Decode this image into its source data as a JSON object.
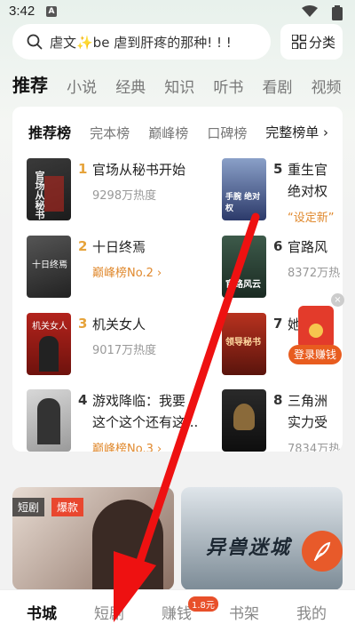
{
  "status": {
    "time": "3:42",
    "notif_letter": "A"
  },
  "search": {
    "placeholder_text": "虐文✨be 虐到肝疼的那种! ! !",
    "category_label": "分类"
  },
  "top_tabs": [
    "推荐",
    "小说",
    "经典",
    "知识",
    "听书",
    "看剧",
    "视频"
  ],
  "rank": {
    "tabs": [
      "推荐榜",
      "完本榜",
      "巅峰榜",
      "口碑榜"
    ],
    "full_label": "完整榜单 ›",
    "books": [
      {
        "num": "1",
        "title": "官场从秘书开始",
        "sub": "9298万热度",
        "cover_text": "官场从秘书"
      },
      {
        "num": "2",
        "title": "十日终焉",
        "sub": "巅峰榜No.2 ›",
        "cover_text": "十日终焉"
      },
      {
        "num": "3",
        "title": "机关女人",
        "sub": "9017万热度",
        "cover_text": "机关女人"
      },
      {
        "num": "4",
        "title1": "游戏降临：我要",
        "title2": "这个这个还有这...",
        "sub": "巅峰榜No.3 ›"
      },
      {
        "num": "5",
        "title1": "重生官",
        "title2": "绝对权",
        "sub": "“设定新”",
        "cover_text": "手腕 绝对权"
      },
      {
        "num": "6",
        "title": "官路风",
        "sub": "8372万热",
        "cover_text": "官路风云"
      },
      {
        "num": "7",
        "title": "她",
        "cover_text": "领导秘书"
      },
      {
        "num": "8",
        "title1": "三角洲",
        "title2": "实力受",
        "sub": "7834万热"
      }
    ]
  },
  "red_packet": {
    "label": "登录赚钱",
    "close": "×"
  },
  "previews": {
    "left_badge1": "短剧",
    "left_badge2": "爆款",
    "right_title": "异兽迷城"
  },
  "bottom_nav": {
    "items": [
      "书城",
      "短剧",
      "赚钱",
      "书架",
      "我的"
    ],
    "earn_badge": "1.8元"
  },
  "colors": {
    "accent": "#e85a2a",
    "arrow": "#ee1111",
    "orange_text": "#e0892e"
  }
}
